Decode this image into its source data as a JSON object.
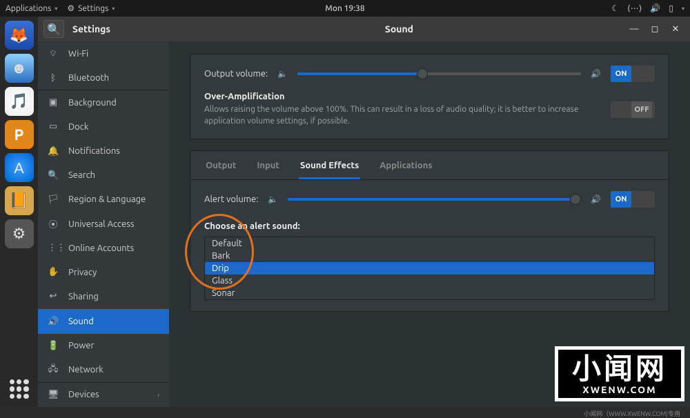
{
  "panel": {
    "applications": "Applications",
    "active_app": "Settings",
    "clock": "Mon 19:38"
  },
  "window": {
    "sidebar_title": "Settings",
    "page_title": "Sound"
  },
  "sidebar": {
    "items": [
      {
        "icon": "wifi-icon",
        "glyph": "⌔",
        "label": "Wi-Fi"
      },
      {
        "icon": "bluetooth-icon",
        "glyph": "ᛒ",
        "label": "Bluetooth"
      },
      {
        "icon": "background-icon",
        "glyph": "▣",
        "label": "Background"
      },
      {
        "icon": "dock-icon",
        "glyph": "▭",
        "label": "Dock"
      },
      {
        "icon": "notifications-icon",
        "glyph": "🔔",
        "label": "Notifications"
      },
      {
        "icon": "search-icon",
        "glyph": "🔍",
        "label": "Search"
      },
      {
        "icon": "region-icon",
        "glyph": "🏳",
        "label": "Region & Language"
      },
      {
        "icon": "universal-access-icon",
        "glyph": "⦿",
        "label": "Universal Access"
      },
      {
        "icon": "online-accounts-icon",
        "glyph": "⋮⋮",
        "label": "Online Accounts"
      },
      {
        "icon": "privacy-icon",
        "glyph": "✋",
        "label": "Privacy"
      },
      {
        "icon": "sharing-icon",
        "glyph": "↩",
        "label": "Sharing"
      },
      {
        "icon": "sound-icon",
        "glyph": "🔊",
        "label": "Sound",
        "active": true
      },
      {
        "icon": "power-icon",
        "glyph": "🔋",
        "label": "Power"
      },
      {
        "icon": "network-icon",
        "glyph": "🖧",
        "label": "Network"
      },
      {
        "icon": "devices-icon",
        "glyph": "🖥",
        "label": "Devices",
        "chevron": true
      }
    ]
  },
  "sound": {
    "output_volume_label": "Output volume:",
    "output_volume_percent": 44,
    "output_on": "ON",
    "overamp_title": "Over-Amplification",
    "overamp_desc": "Allows raising the volume above 100%. This can result in a loss of audio quality; it is better to increase application volume settings, if possible.",
    "overamp_state": "OFF",
    "tabs": [
      "Output",
      "Input",
      "Sound Effects",
      "Applications"
    ],
    "active_tab": 2,
    "alert_volume_label": "Alert volume:",
    "alert_volume_percent": 98,
    "alert_on": "ON",
    "choose_label": "Choose an alert sound:",
    "alert_sounds": [
      "Default",
      "Bark",
      "Drip",
      "Glass",
      "Sonar"
    ],
    "selected_sound": "Drip"
  },
  "watermark": {
    "big": "小闻网",
    "small": "XWENW.COM",
    "footer": "小闻网（WWW.XWENW.COM)专用"
  },
  "colors": {
    "accent": "#1b6acb",
    "annotation": "#e2701d"
  }
}
